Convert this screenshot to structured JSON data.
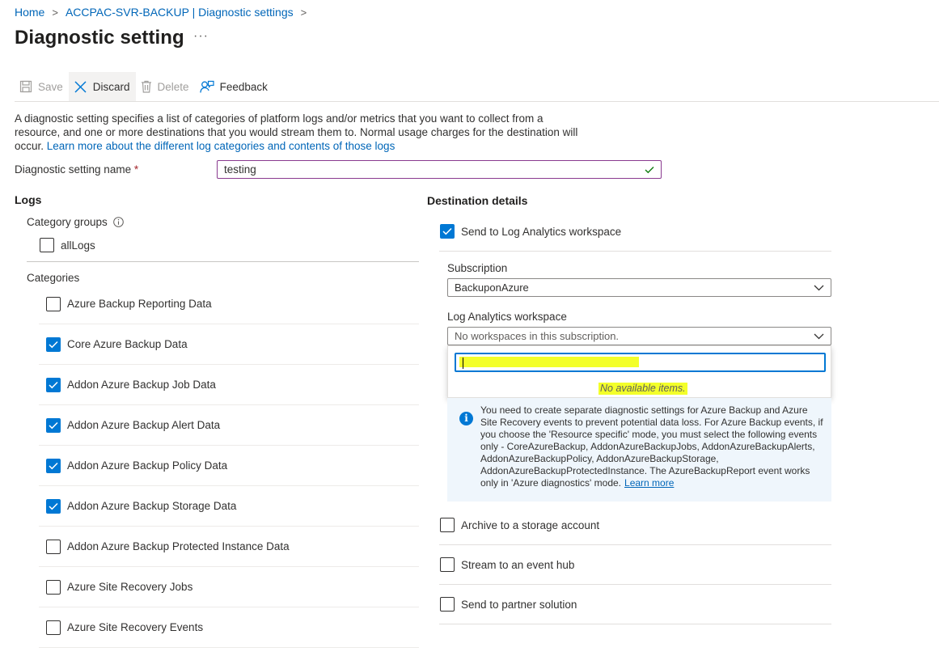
{
  "breadcrumb": {
    "items": [
      {
        "label": "Home"
      },
      {
        "label": "ACCPAC-SVR-BACKUP | Diagnostic settings"
      }
    ],
    "separator": ">"
  },
  "page": {
    "title": "Diagnostic setting",
    "more": "···"
  },
  "toolbar": {
    "save": "Save",
    "discard": "Discard",
    "delete": "Delete",
    "feedback": "Feedback"
  },
  "description": {
    "text": "A diagnostic setting specifies a list of categories of platform logs and/or metrics that you want to collect from a resource, and one or more destinations that you would stream them to. Normal usage charges for the destination will occur. ",
    "link": "Learn more about the different log categories and contents of those logs"
  },
  "name_field": {
    "label": "Diagnostic setting name",
    "required_mark": "*",
    "value": "testing"
  },
  "logs": {
    "heading": "Logs",
    "category_groups_label": "Category groups",
    "groups": [
      {
        "label": "allLogs",
        "checked": false
      }
    ],
    "categories_label": "Categories",
    "categories": [
      {
        "label": "Azure Backup Reporting Data",
        "checked": false
      },
      {
        "label": "Core Azure Backup Data",
        "checked": true
      },
      {
        "label": "Addon Azure Backup Job Data",
        "checked": true
      },
      {
        "label": "Addon Azure Backup Alert Data",
        "checked": true
      },
      {
        "label": "Addon Azure Backup Policy Data",
        "checked": true
      },
      {
        "label": "Addon Azure Backup Storage Data",
        "checked": true
      },
      {
        "label": "Addon Azure Backup Protected Instance Data",
        "checked": false
      },
      {
        "label": "Azure Site Recovery Jobs",
        "checked": false
      },
      {
        "label": "Azure Site Recovery Events",
        "checked": false
      }
    ]
  },
  "destination": {
    "heading": "Destination details",
    "log_analytics": {
      "label": "Send to Log Analytics workspace",
      "checked": true
    },
    "subscription_label": "Subscription",
    "subscription_value": "BackuponAzure",
    "workspace_label": "Log Analytics workspace",
    "workspace_placeholder": "No workspaces in this subscription.",
    "search_value": "",
    "no_items": "No available items.",
    "info_text": "You need to create separate diagnostic settings for Azure Backup and Azure Site Recovery events to prevent potential data loss. For Azure Backup events, if you choose the 'Resource specific' mode, you must select the following events only - CoreAzureBackup, AddonAzureBackupJobs, AddonAzureBackupAlerts, AddonAzureBackupPolicy, AddonAzureBackupStorage, AddonAzureBackupProtectedInstance. The AzureBackupReport event works only in 'Azure diagnostics' mode.",
    "info_link": "Learn more",
    "archive": {
      "label": "Archive to a storage account",
      "checked": false
    },
    "event_hub": {
      "label": "Stream to an event hub",
      "checked": false
    },
    "partner": {
      "label": "Send to partner solution",
      "checked": false
    }
  },
  "colors": {
    "accent": "#0078d4",
    "link": "#0066b8",
    "highlight": "#f3ff2a",
    "input_border": "#8a3a8f",
    "valid": "#107c10"
  }
}
